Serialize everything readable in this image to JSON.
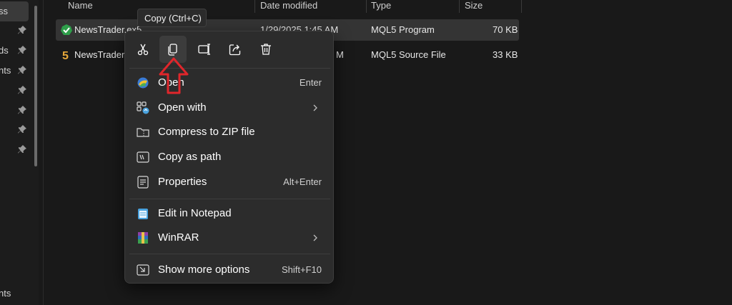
{
  "nav": {
    "items": [
      {
        "label": "ss",
        "pinned": false
      },
      {
        "label": "",
        "pinned": true
      },
      {
        "label": "ds",
        "pinned": true
      },
      {
        "label": "nts",
        "pinned": true
      },
      {
        "label": "",
        "pinned": true
      },
      {
        "label": "",
        "pinned": true
      },
      {
        "label": "",
        "pinned": true
      },
      {
        "label": "",
        "pinned": true
      }
    ],
    "bottom_label": "nts"
  },
  "columns": {
    "name": "Name",
    "date_modified": "Date modified",
    "type": "Type",
    "size": "Size"
  },
  "files": [
    {
      "name": "NewsTrader.ex5",
      "date": "1/29/2025 1:45 AM",
      "type": "MQL5 Program",
      "size": "70 KB",
      "icon": "mql5-program-icon",
      "selected": true
    },
    {
      "name": "NewsTrader.",
      "date": "M",
      "type": "MQL5 Source File",
      "size": "33 KB",
      "icon": "mql5-source-icon",
      "selected": false
    }
  ],
  "tooltip": "Copy (Ctrl+C)",
  "context_menu": {
    "quick_actions": [
      {
        "name": "cut",
        "icon": "scissors-icon"
      },
      {
        "name": "copy",
        "icon": "copy-icon",
        "active": true
      },
      {
        "name": "rename",
        "icon": "rename-icon"
      },
      {
        "name": "share",
        "icon": "share-icon"
      },
      {
        "name": "delete",
        "icon": "trash-icon"
      }
    ],
    "items": {
      "open": {
        "label": "Open",
        "shortcut": "Enter",
        "icon": "metatrader-icon"
      },
      "open_with": {
        "label": "Open with",
        "icon": "open-with-icon"
      },
      "compress": {
        "label": "Compress to ZIP file",
        "icon": "zip-folder-icon"
      },
      "copy_path": {
        "label": "Copy as path",
        "icon": "path-icon"
      },
      "properties": {
        "label": "Properties",
        "shortcut": "Alt+Enter",
        "icon": "properties-icon"
      },
      "notepad": {
        "label": "Edit in Notepad",
        "icon": "notepad-icon"
      },
      "winrar": {
        "label": "WinRAR",
        "icon": "winrar-icon"
      },
      "more_options": {
        "label": "Show more options",
        "shortcut": "Shift+F10",
        "icon": "more-options-icon"
      }
    }
  },
  "colors": {
    "annotation_arrow": "#e0262b",
    "accent_blue": "#4aa3df"
  }
}
